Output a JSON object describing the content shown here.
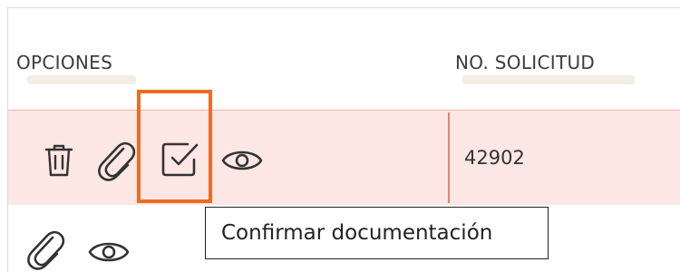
{
  "table": {
    "columns": [
      "OPCIONES",
      "NO. SOLICITUD"
    ],
    "rows": [
      {
        "no_solicitud": "42902",
        "actions": [
          "trash-icon",
          "paperclip-icon",
          "check-square-icon",
          "eye-icon"
        ]
      },
      {
        "no_solicitud": "",
        "actions": [
          "paperclip-icon",
          "eye-icon"
        ]
      }
    ]
  },
  "tooltip": {
    "text": "Confirmar documentación"
  },
  "colors": {
    "row_highlight_bg": "#fde7e4",
    "row_divider": "#e6826f",
    "focus_outline": "#ef6b21",
    "icon_stroke": "#333333"
  }
}
